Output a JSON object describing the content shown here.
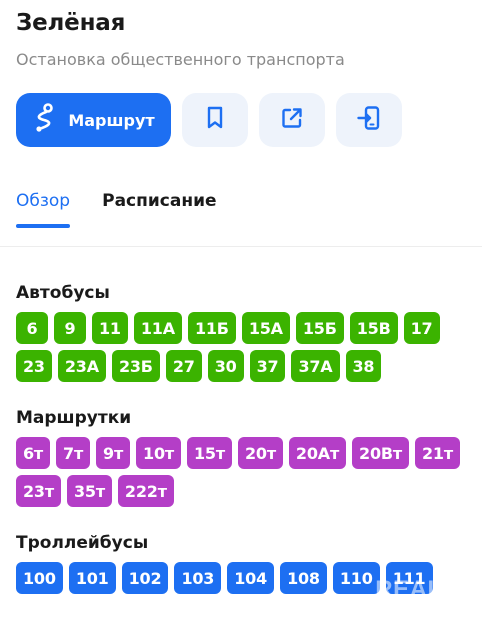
{
  "header": {
    "title": "Зелёная",
    "subtitle": "Остановка общественного транспорта"
  },
  "actions": {
    "route_label": "Маршрут",
    "icons": [
      "route-icon",
      "bookmark-icon",
      "share-icon",
      "send-to-phone-icon"
    ]
  },
  "tabs": [
    {
      "label": "Обзор",
      "active": true
    },
    {
      "label": "Расписание",
      "active": false
    }
  ],
  "sections": {
    "buses": {
      "title": "Автобусы",
      "color": "#3bb300",
      "routes": [
        "6",
        "9",
        "11",
        "11А",
        "11Б",
        "15А",
        "15Б",
        "15В",
        "17",
        "23",
        "23А",
        "23Б",
        "27",
        "30",
        "37",
        "37А",
        "38"
      ]
    },
    "minibuses": {
      "title": "Маршрутки",
      "color": "#b43ec7",
      "routes": [
        "6т",
        "7т",
        "9т",
        "10т",
        "15т",
        "20т",
        "20Ат",
        "20Вт",
        "21т",
        "23т",
        "35т",
        "222т"
      ]
    },
    "trolleybuses": {
      "title": "Троллейбусы",
      "color": "#1d6ff2",
      "routes": [
        "100",
        "101",
        "102",
        "103",
        "104",
        "108",
        "110",
        "111"
      ]
    }
  },
  "watermark": "REALT",
  "colors": {
    "accent": "#1d6ff2",
    "icon_button_bg": "#eef3fb"
  }
}
